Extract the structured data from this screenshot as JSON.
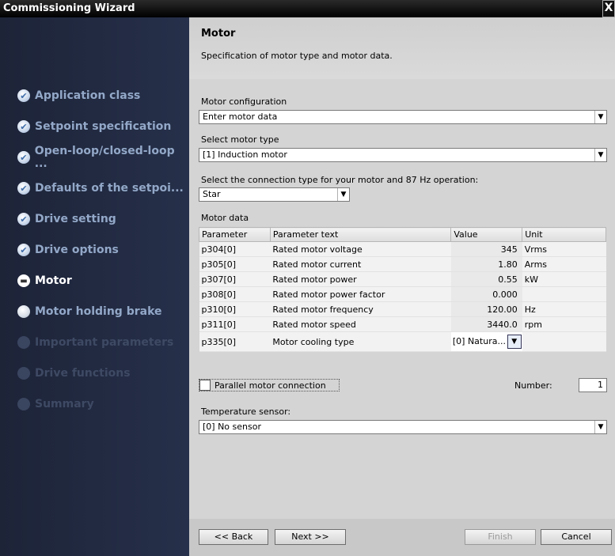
{
  "window": {
    "title": "Commissioning Wizard",
    "close_glyph": "X"
  },
  "sidebar": {
    "items": [
      {
        "label": "Application class",
        "state": "done"
      },
      {
        "label": "Setpoint specification",
        "state": "done"
      },
      {
        "label": "Open-loop/closed-loop ...",
        "state": "done"
      },
      {
        "label": "Defaults of the setpoi...",
        "state": "done"
      },
      {
        "label": "Drive setting",
        "state": "done"
      },
      {
        "label": "Drive options",
        "state": "done"
      },
      {
        "label": "Motor",
        "state": "current"
      },
      {
        "label": "Motor holding brake",
        "state": "next"
      },
      {
        "label": "Important parameters",
        "state": "disabled"
      },
      {
        "label": "Drive functions",
        "state": "disabled"
      },
      {
        "label": "Summary",
        "state": "disabled"
      }
    ]
  },
  "header": {
    "title": "Motor",
    "subtitle": "Specification of motor type and motor data."
  },
  "form": {
    "motor_config": {
      "label": "Motor configuration",
      "value": "Enter motor data"
    },
    "motor_type": {
      "label": "Select motor type",
      "value": "[1] Induction motor"
    },
    "connection": {
      "label": "Select the connection type for your motor and 87 Hz operation:",
      "value": "Star"
    },
    "motor_data_label": "Motor data",
    "parallel_label": "Parallel motor connection",
    "number_label": "Number:",
    "number_value": "1",
    "temp_sensor": {
      "label": "Temperature sensor:",
      "value": "[0] No sensor"
    }
  },
  "table": {
    "headers": [
      "Parameter",
      "Parameter text",
      "Value",
      "Unit"
    ],
    "rows": [
      {
        "param": "p304[0]",
        "text": "Rated motor voltage",
        "value": "345",
        "unit": "Vrms"
      },
      {
        "param": "p305[0]",
        "text": "Rated motor current",
        "value": "1.80",
        "unit": "Arms"
      },
      {
        "param": "p307[0]",
        "text": "Rated motor power",
        "value": "0.55",
        "unit": "kW"
      },
      {
        "param": "p308[0]",
        "text": "Rated motor power factor",
        "value": "0.000",
        "unit": ""
      },
      {
        "param": "p310[0]",
        "text": "Rated motor frequency",
        "value": "120.00",
        "unit": "Hz"
      },
      {
        "param": "p311[0]",
        "text": "Rated motor speed",
        "value": "3440.0",
        "unit": "rpm"
      },
      {
        "param": "p335[0]",
        "text": "Motor cooling type",
        "value": "[0] Natura...",
        "unit": ""
      }
    ]
  },
  "buttons": {
    "back": "<< Back",
    "next": "Next >>",
    "finish": "Finish",
    "cancel": "Cancel"
  }
}
